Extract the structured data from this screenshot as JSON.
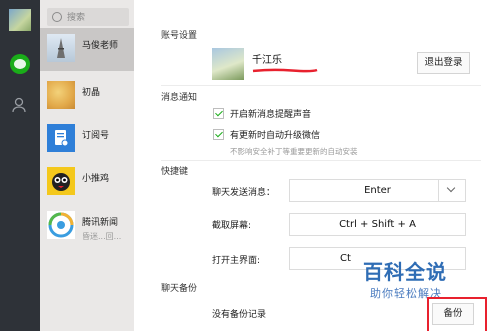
{
  "sidebar": {
    "search_placeholder": "搜索",
    "chats": [
      {
        "name": "马俊老师",
        "sub": ""
      },
      {
        "name": "初晶",
        "sub": ""
      },
      {
        "name": "订阅号",
        "sub": ""
      },
      {
        "name": "小推鸡",
        "sub": ""
      },
      {
        "name": "腾讯新闻",
        "sub": "昏迷...回..."
      }
    ]
  },
  "settings": {
    "account_section": "账号设置",
    "profile_name": "千江乐",
    "logout_label": "退出登录",
    "notify_section": "消息通知",
    "notify_sound_label": "开启新消息提醒声音",
    "auto_update_label": "有更新时自动升级微信",
    "auto_update_sub": "不影响安全补丁等重要更新的自动安装",
    "shortcut_section": "快捷键",
    "send_label": "聊天发送消息：",
    "send_value": "Enter",
    "screenshot_label": "截取屏幕:",
    "screenshot_value": "Ctrl + Shift + A",
    "open_main_label": "打开主界面:",
    "open_main_value": "Ct",
    "backup_section": "聊天备份",
    "no_backup_text": "没有备份记录",
    "backup_button": "备份"
  },
  "watermark": {
    "title": "百科全说",
    "subtitle": "助你轻松解决"
  },
  "colors": {
    "accent_green": "#1aad19",
    "highlight_red": "#e8212e",
    "watermark_blue": "#2f6db5"
  }
}
